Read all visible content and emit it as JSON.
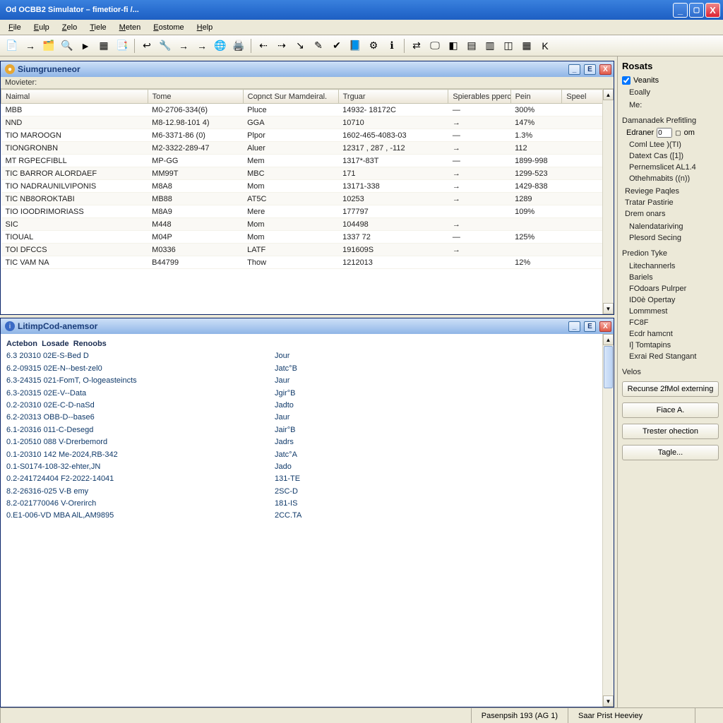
{
  "window": {
    "title": "Od OCBB2 Simulator – fimetior-fi /..."
  },
  "menu": [
    "File",
    "Eulp",
    "Zelo",
    "Tiele",
    "Meten",
    "Eostome",
    "Help"
  ],
  "toolbar_icons": [
    "📄",
    "→",
    "🗂️",
    "🔍",
    "►",
    "▦",
    "📑",
    "|",
    "↩",
    "🔧",
    "→",
    "→",
    "🌐",
    "🖨️",
    "|",
    "⇠",
    "⇢",
    "↘",
    "✎",
    "✔",
    "📘",
    "⚙",
    "ℹ",
    "|",
    "⇄",
    "🖵",
    "◧",
    "▤",
    "▥",
    "◫",
    "▦",
    "K"
  ],
  "panel_top": {
    "title": "Siumgruneneor",
    "sublabel": "Movieter:",
    "columns": [
      "Naimal",
      "Tome",
      "Copnct Sur Mamdeiral.",
      "Trguar",
      "Spierables pperc.",
      "Pein",
      "Speel"
    ],
    "col_widths": [
      "200px",
      "130px",
      "130px",
      "150px",
      "85px",
      "70px",
      "70px"
    ],
    "rows": [
      [
        "MBB",
        "M0-2706-334(6)",
        "Pluce",
        "14932- 18172C",
        "—",
        "300%",
        ""
      ],
      [
        "NND",
        "M8-12.98-101 4)",
        "GGA",
        "10710",
        "→",
        "147%",
        ""
      ],
      [
        "TIO MAROOGN",
        "M6-3371-86 (0)",
        "Plpor",
        "1602-465-4083-03",
        "—",
        "1.3%",
        ""
      ],
      [
        "TIONGRONBN",
        "M2-3322-289-47",
        "Aluer",
        "12317 , 287 , -112",
        "→",
        "112",
        ""
      ],
      [
        "MT RGPECFIBLL",
        "MP-GG",
        "Mem",
        "1317*-83T",
        "—",
        "1899-998",
        ""
      ],
      [
        "TIC BARROR ALORDAEF",
        "MM99T",
        "MBC",
        "171",
        "→",
        "1299-523",
        ""
      ],
      [
        "TIO NADRAUNILVIPONIS",
        "M8A8",
        "Mom",
        "13171-338",
        "→",
        "1429-838",
        ""
      ],
      [
        "TIC NB8OROKTABI",
        "MB88",
        "AT5C",
        "10253",
        "→",
        "1289",
        ""
      ],
      [
        "TIO IOODRIMORIASS",
        "M8A9",
        "Mere",
        "177797",
        "",
        "109%",
        ""
      ],
      [
        "SIC",
        "M448",
        "Mom",
        "104498",
        "→",
        "",
        ""
      ],
      [
        "TIOUAL",
        "M04P",
        "Mom",
        "1337 72",
        "—",
        "125%",
        ""
      ],
      [
        "TOI DFCCS",
        "M0336",
        "LATF",
        "191609S",
        "→",
        "",
        ""
      ],
      [
        "TIC VAM NA",
        "B44799",
        "Thow",
        "1212013",
        "",
        "12%",
        ""
      ]
    ]
  },
  "panel_bottom": {
    "title": "LitimpCod-anemsor",
    "header": "Actebon  Losade  Renoobs",
    "rows": [
      [
        "6.3 20310 02E-S-Bed D",
        "Jour"
      ],
      [
        "6.2-09315 02E-N--best-zel0",
        "Jatc°B"
      ],
      [
        "6.3-24315 021-FomT, O-logeasteincts",
        "Jaur"
      ],
      [
        "6.3-20315 02E-V--Data",
        "Jgir°B"
      ],
      [
        "0.2-20310 02E-C-D-naSd",
        "Jadto"
      ],
      [
        "6.2-20313 OBB-D--base6",
        "Jaur"
      ],
      [
        "6.1-20316 011-C-Desegd",
        "Jair°B"
      ],
      [
        "0.1-20510 088 V-Drerbemord",
        "Jadrs"
      ],
      [
        "0.1-20310 142 Me-2024,RB-342",
        "Jatc°A"
      ],
      [
        "0.1-S0174-108-32-ehter,JN",
        "Jado"
      ],
      [
        "0.2-241724404 F2-2022-14041",
        "131-TE"
      ],
      [
        "8.2-26316-025 V-B emy",
        "2SC-D"
      ],
      [
        "8.2-021770046 V-Orerirch",
        "181-IS"
      ],
      [
        "0.E1-006-VD MBA AlL,AM9895",
        "2CC.TA"
      ]
    ]
  },
  "sidebar": {
    "title": "Rosats",
    "check1": "Veanits",
    "items_top": [
      "Eoally",
      "Me:"
    ],
    "section1": "Damanadek Prefitling",
    "row_label": "Edraner",
    "row_unit": "om",
    "indented1": [
      "Coml Ltee )(TI)",
      "Datext Cas ([1])",
      "Pernemslicet AL1.4",
      "Othehmabits ((n))"
    ],
    "section2_items": [
      "Reviege Paqles",
      "Tratar Pastirie",
      "Drem onars"
    ],
    "indented2": [
      "Nalendatariving",
      "Plesord Secing"
    ],
    "section3": "Predion Tyke",
    "indented3": [
      "Litechannerls",
      "Bariels",
      "FOdoars Pulrper",
      "ID0è Opertay",
      "Lommmest",
      "FC8F",
      "Ecdr hamcnt",
      "I] Tomtapins",
      "Exrai Red Stangant"
    ],
    "section4": "Velos",
    "buttons": [
      "Recunse 2fMol externing",
      "Fiace A.",
      "Trester ohection",
      "Tagle..."
    ]
  },
  "status": {
    "center": "Pasenpsih 193 (AG 1)",
    "right": "Saar Prist Heeviey"
  }
}
